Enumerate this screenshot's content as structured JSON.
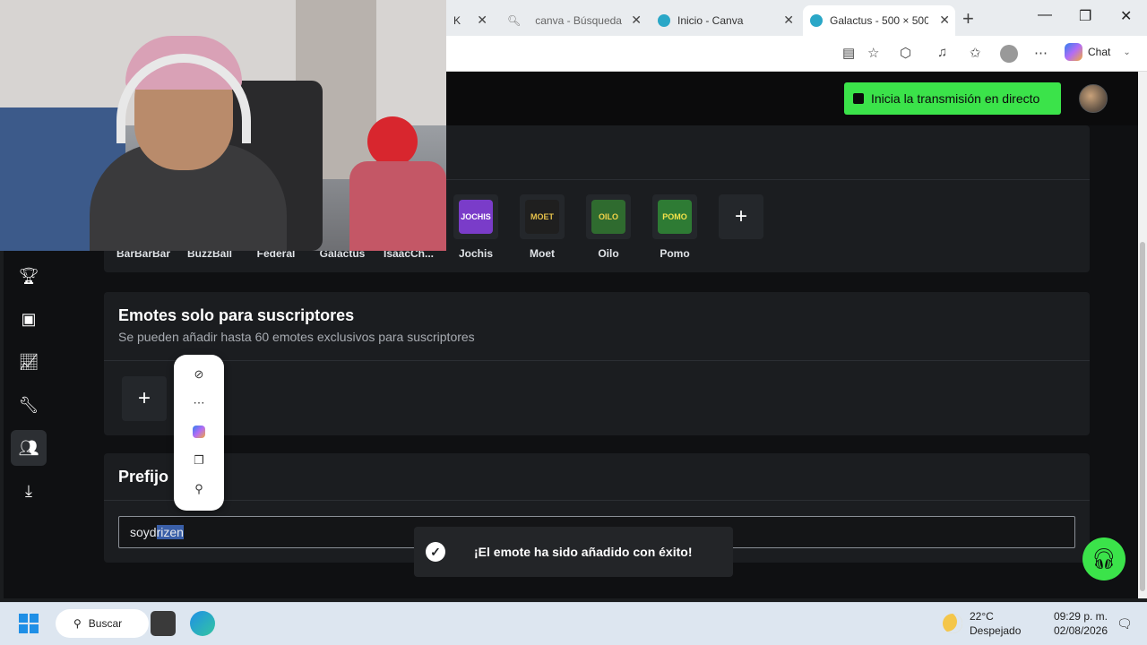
{
  "browser": {
    "tabs": [
      {
        "title": "K",
        "active": false
      },
      {
        "title": "canva - Búsqueda",
        "active": false
      },
      {
        "title": "Inicio - Canva",
        "active": false
      },
      {
        "title": "Galactus - 500 × 500",
        "active": true
      }
    ],
    "copilot_label": "Chat"
  },
  "header": {
    "golive_label": "Inicia la transmisión en directo"
  },
  "emotes": {
    "labels_partial": [
      "BarBarBar",
      "BuzzBall",
      "Federal",
      "Galactus",
      "IsaacCh..."
    ],
    "items": [
      {
        "name": "Jochis",
        "badge": "JOCHIS",
        "color": "#7a3cc9"
      },
      {
        "name": "Moet",
        "badge": "MOET",
        "color": "#1f1f1f"
      },
      {
        "name": "Oilo",
        "badge": "OILO",
        "color": "#2f6b2f"
      },
      {
        "name": "Pomo",
        "badge": "POMO",
        "color": "#2e7b34"
      }
    ],
    "add_icon": "+"
  },
  "subscriber_emotes": {
    "title": "Emotes solo para suscriptores",
    "subtitle": "Se pueden añadir hasta 60 emotes exclusivos para suscriptores",
    "add_icon": "+"
  },
  "prefix": {
    "title": "Prefijo",
    "value_plain": "soyd",
    "value_selected": "rizen"
  },
  "context_menu": {
    "items": [
      "eye-off-icon",
      "more-icon",
      "copilot-icon",
      "copy-icon",
      "search-icon"
    ]
  },
  "toast": {
    "message": "¡El emote ha sido añadido con éxito!"
  },
  "taskbar": {
    "search_label": "Buscar",
    "weather_temp": "22°C",
    "weather_desc": "Despejado",
    "time": "09:29 p. m.",
    "date": "02/08/2026"
  },
  "colors": {
    "accent": "#3be34a",
    "page_bg": "#0f1012",
    "card_bg": "#1b1d20"
  }
}
